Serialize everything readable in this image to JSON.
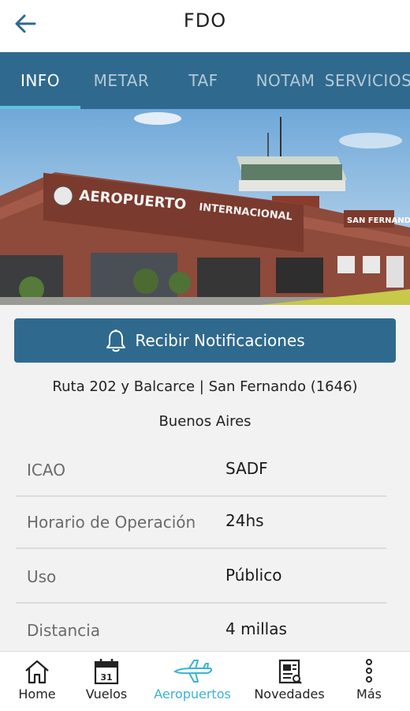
{
  "header": {
    "title": "FDO",
    "back_icon": "arrow-left-icon"
  },
  "tabs": [
    {
      "label": "INFO",
      "active": true
    },
    {
      "label": "METAR",
      "active": false
    },
    {
      "label": "TAF",
      "active": false
    },
    {
      "label": "NOTAM",
      "active": false
    },
    {
      "label": "SERVICIOS",
      "active": false
    }
  ],
  "hero": {
    "sign_main": "AEROPUERTO",
    "sign_intl": "INTERNACIONAL",
    "sign_city": "SAN FERNANDO"
  },
  "notify": {
    "label": "Recibir Notificaciones",
    "icon": "bell-icon"
  },
  "address": {
    "line1": "Ruta 202 y Balcarce  |  San Fernando (1646)",
    "line2": "Buenos Aires"
  },
  "details": [
    {
      "key": "ICAO",
      "value": "SADF"
    },
    {
      "key": "Horario de Operación",
      "value": "24hs"
    },
    {
      "key": "Uso",
      "value": "Público"
    },
    {
      "key": "Distancia",
      "value": "4 millas"
    }
  ],
  "bottom_nav": [
    {
      "label": "Home",
      "icon": "home-icon",
      "active": false
    },
    {
      "label": "Vuelos",
      "icon": "calendar-icon",
      "calendar_day": "31",
      "active": false
    },
    {
      "label": "Aeropuertos",
      "icon": "airplane-icon",
      "active": true
    },
    {
      "label": "Novedades",
      "icon": "news-icon",
      "active": false
    },
    {
      "label": "Más",
      "icon": "more-vertical-icon",
      "active": false
    }
  ],
  "colors": {
    "primary": "#2f6a8e",
    "accent": "#3ab3d6",
    "tab_indicator": "#62c0dd"
  }
}
